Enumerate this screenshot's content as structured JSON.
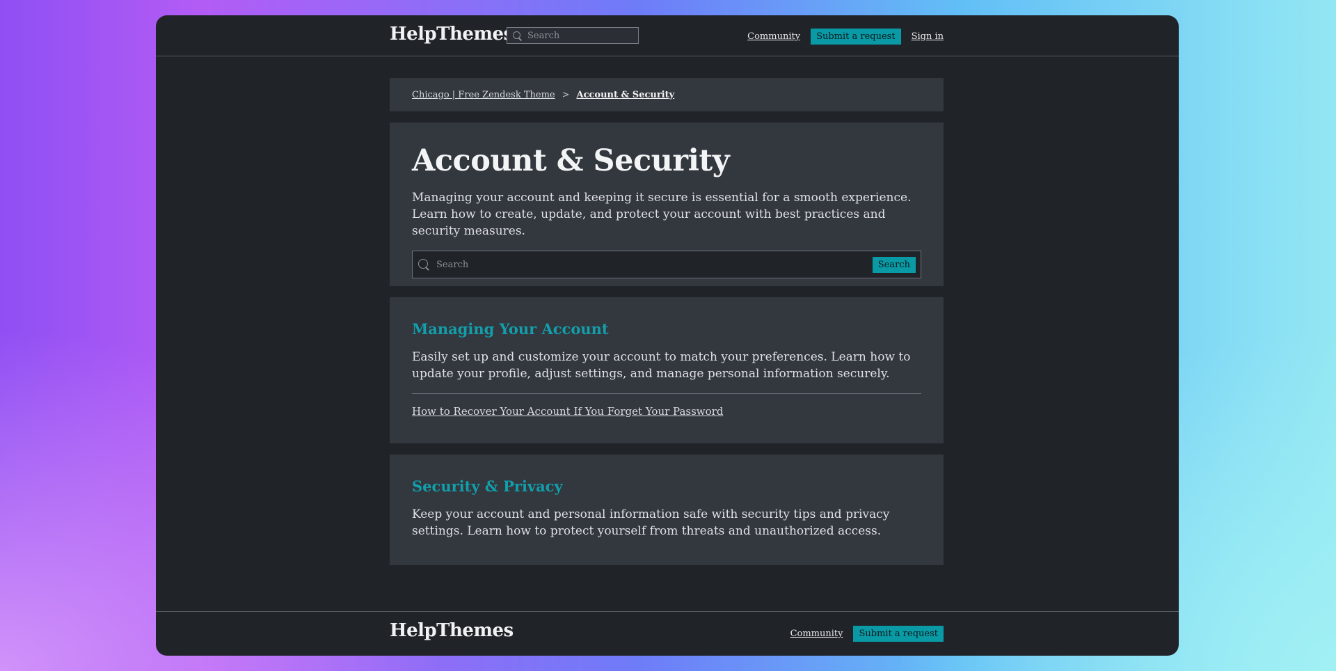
{
  "header": {
    "brand": "HelpThemes",
    "search_placeholder": "Search",
    "nav": {
      "community": "Community",
      "submit_request": "Submit a request",
      "sign_in": "Sign in"
    }
  },
  "breadcrumb": {
    "items": [
      "Chicago | Free Zendesk Theme",
      "Account & Security"
    ],
    "separator": ">"
  },
  "hero": {
    "title": "Account & Security",
    "description": "Managing your account and keeping it secure is essential for a smooth experience. Learn how to create, update, and protect your account with best practices and security measures.",
    "search_placeholder": "Search",
    "search_button": "Search"
  },
  "sections": [
    {
      "title": "Managing Your Account",
      "description": "Easily set up and customize your account to match your preferences. Learn how to update your profile, adjust settings, and manage personal information securely.",
      "articles": [
        "How to Recover Your Account If You Forget Your Password"
      ]
    },
    {
      "title": "Security & Privacy",
      "description": "Keep your account and personal information safe with security tips and privacy settings. Learn how to protect yourself from threats and unauthorized access."
    }
  ],
  "footer": {
    "brand": "HelpThemes",
    "community": "Community",
    "submit_request": "Submit a request"
  },
  "colors": {
    "accent": "#0a9aa6",
    "section_title": "#129eaa",
    "page_background": "#202328",
    "panel_background": "#33373e"
  },
  "icons": {
    "header_search": "search-icon",
    "hero_search": "search-icon"
  }
}
